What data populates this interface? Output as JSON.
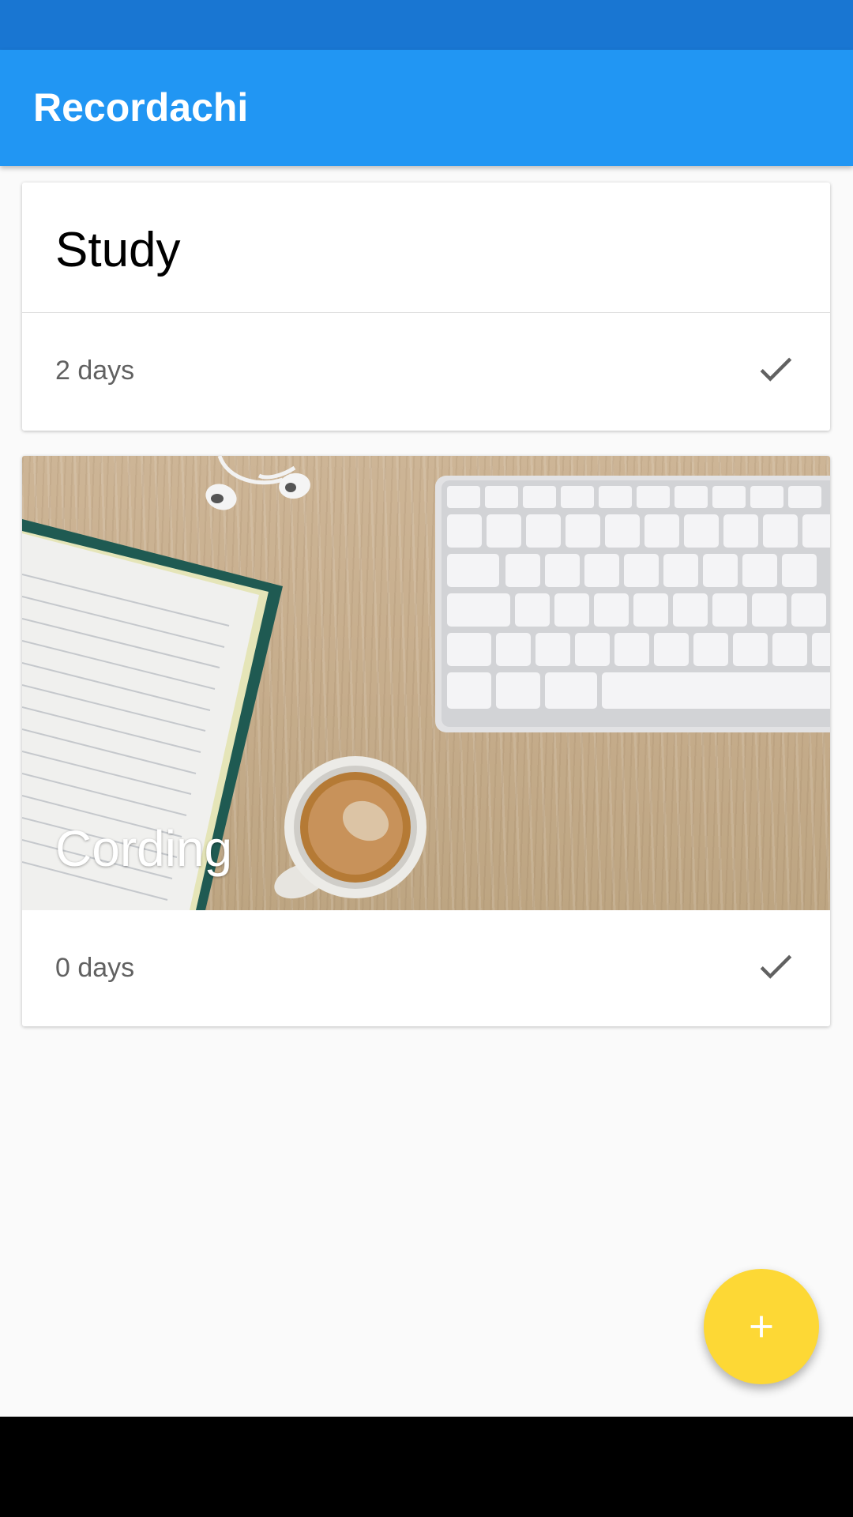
{
  "app": {
    "title": "Recordachi"
  },
  "colors": {
    "status_bar": "#1976d2",
    "app_bar": "#2196f3",
    "fab": "#fdd835"
  },
  "cards": [
    {
      "title": "Study",
      "days": "2 days",
      "action_icon": "check-icon"
    },
    {
      "title": "Cording",
      "days": "0 days",
      "action_icon": "check-icon",
      "image": "desk with notebook, keyboard, coffee cup and earphones"
    }
  ],
  "fab": {
    "icon": "plus-icon"
  }
}
